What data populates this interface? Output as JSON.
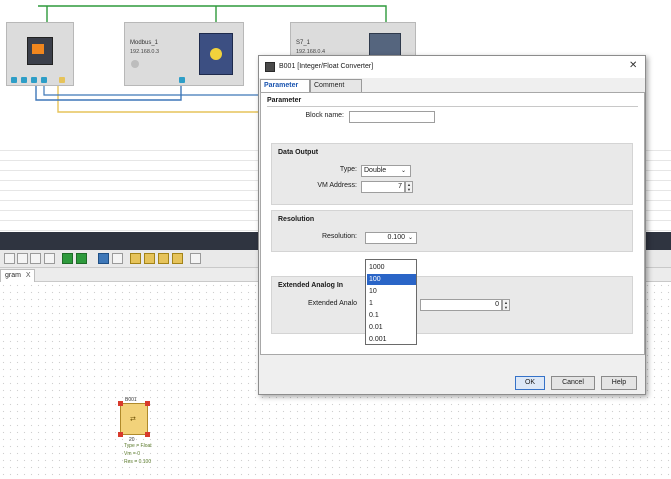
{
  "network": {
    "devices": [
      {
        "name": "",
        "ip": ""
      },
      {
        "name": "Modbus_1",
        "ip": "192.168.0.3"
      },
      {
        "name": "S7_1",
        "ip": "192.168.0.4"
      }
    ]
  },
  "editor": {
    "diagram_tab": "gram",
    "diagram_tab_close": "X",
    "block": {
      "id": "B001",
      "pin": "20",
      "info": [
        "Type = Float",
        "Vm = 0",
        "Res = 0.100"
      ]
    }
  },
  "dialog": {
    "title": "B001 [Integer/Float Converter]",
    "close": "✕",
    "tabs": [
      "Parameter",
      "Comment"
    ],
    "active_tab": "Parameter",
    "section_title": "Parameter",
    "block_name_label": "Block name:",
    "block_name_value": "",
    "data_output": {
      "title": "Data Output",
      "type_label": "Type:",
      "type_value": "Double",
      "vm_label": "VM Address:",
      "vm_value": "7"
    },
    "resolution": {
      "title": "Resolution",
      "label": "Resolution:",
      "value": "0.100",
      "options": [
        "1000",
        "100",
        "10",
        "1",
        "0.1",
        "0.01",
        "0.001"
      ],
      "highlighted": "100"
    },
    "extended": {
      "title": "Extended Analog In",
      "label": "Extended Analo",
      "value": "0"
    },
    "buttons": {
      "ok": "OK",
      "cancel": "Cancel",
      "help": "Help"
    }
  },
  "colors": {
    "accent": "#2a65c7",
    "link_green": "#2e9a3c",
    "link_yellow": "#e6c35a",
    "link_blue": "#3e77b8",
    "dark_bar": "#2f3440"
  }
}
